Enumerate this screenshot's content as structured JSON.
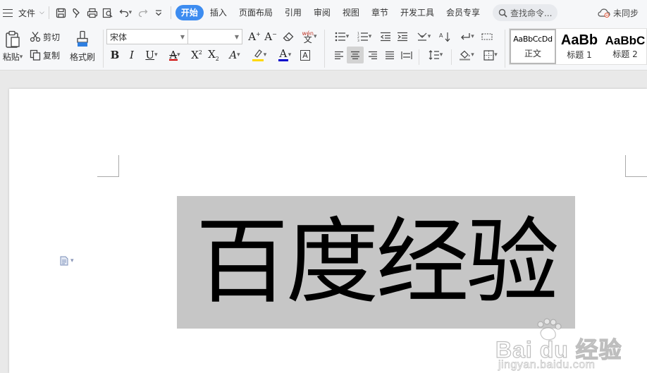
{
  "menu": {
    "file_label": "文件",
    "tabs": [
      {
        "label": "开始",
        "active": true
      },
      {
        "label": "插入"
      },
      {
        "label": "页面布局"
      },
      {
        "label": "引用"
      },
      {
        "label": "审阅"
      },
      {
        "label": "视图"
      },
      {
        "label": "章节"
      },
      {
        "label": "开发工具"
      },
      {
        "label": "会员专享"
      }
    ],
    "search_placeholder": "查找命令...",
    "sync_label": "未同步"
  },
  "ribbon": {
    "paste_label": "粘贴",
    "cut_label": "剪切",
    "copy_label": "复制",
    "format_painter_label": "格式刷",
    "font_name": "宋体",
    "font_size": "",
    "underline_color": "#cc0000",
    "highlight_color": "#ffd800",
    "font_color": "#0000cc",
    "phonetic_glyph": "wén",
    "styles": [
      {
        "preview": "AaBbCcDd",
        "label": "正文",
        "selected": true
      },
      {
        "preview": "AaBb",
        "label": "标题 1"
      },
      {
        "preview": "AaBbC",
        "label": "标题 2"
      }
    ]
  },
  "document": {
    "selected_text": "百度经验",
    "selection_color": "#c6c6c6"
  },
  "watermark": {
    "brand": "Bai du 经验",
    "url": "jingyan.baidu.com"
  }
}
